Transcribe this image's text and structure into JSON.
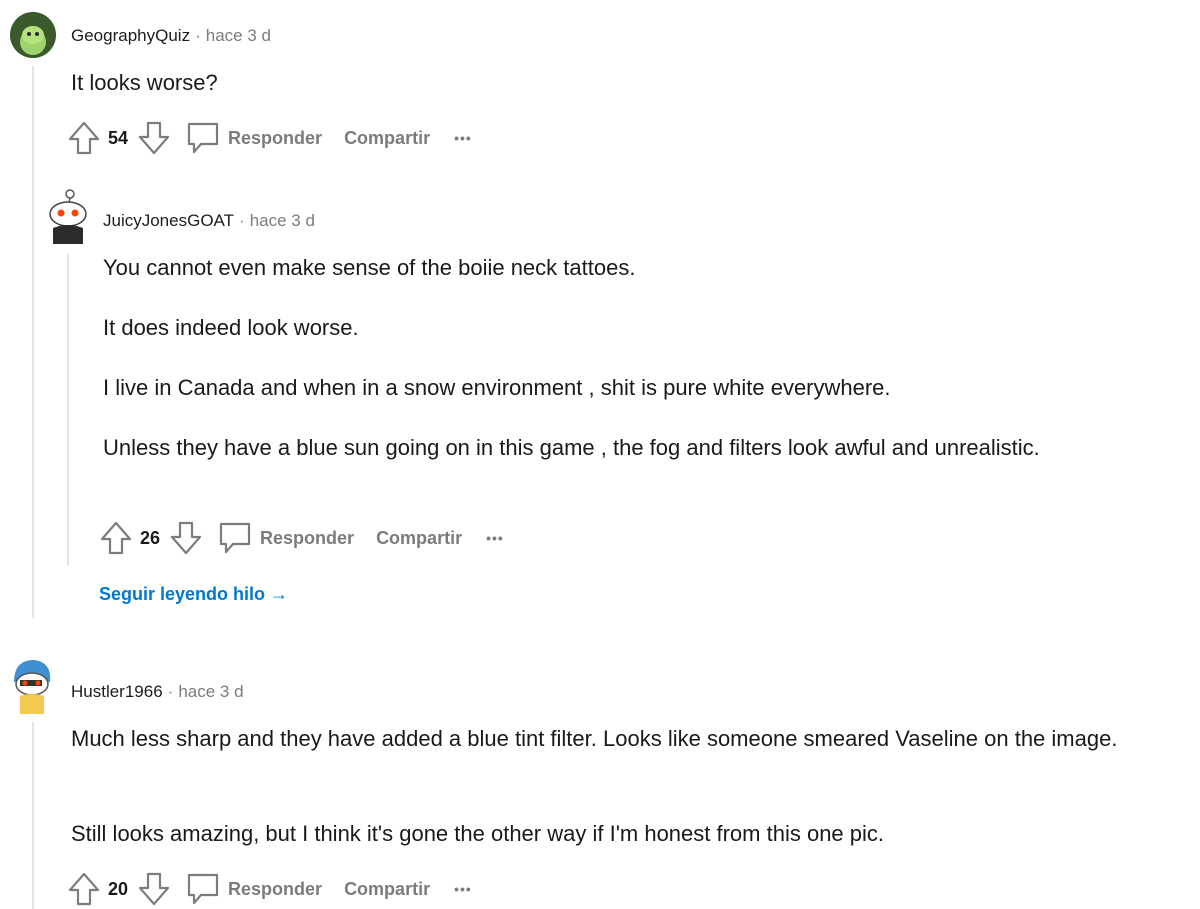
{
  "comments": [
    {
      "author": "GeographyQuiz",
      "time": "hace 3 d",
      "paragraphs": [
        "It looks worse?"
      ],
      "score": "54",
      "reply_label": "Responder",
      "share_label": "Compartir",
      "more_label": "•••"
    },
    {
      "author": "JuicyJonesGOAT",
      "time": "hace 3 d",
      "paragraphs": [
        "You cannot even make sense of the boiie neck tattoes.",
        "It does indeed look worse.",
        "I live in Canada and when in a snow environment , shit is pure white everywhere.",
        "Unless they have a blue sun going on in this game , the fog and filters look awful and unrealistic."
      ],
      "score": "26",
      "reply_label": "Responder",
      "share_label": "Compartir",
      "more_label": "•••",
      "continue_thread": "Seguir leyendo hilo →"
    },
    {
      "author": "Hustler1966",
      "time": "hace 3 d",
      "paragraphs": [
        "Much less sharp and they have added a blue tint filter. Looks like someone smeared Vaseline on the image.",
        "Still looks amazing, but I think it's gone the other way if I'm honest from this one pic."
      ],
      "score": "20",
      "reply_label": "Responder",
      "share_label": "Compartir",
      "more_label": "•••"
    }
  ],
  "separator": "·",
  "colors": {
    "thread_line": "#e5e5e5",
    "link": "#0079d3",
    "muted": "#7c7c7c"
  }
}
